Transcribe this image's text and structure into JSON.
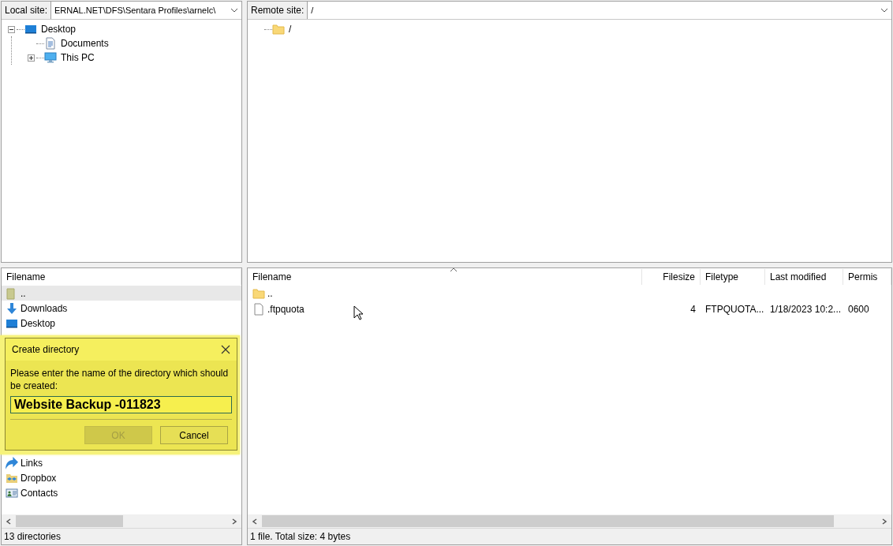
{
  "local_site": {
    "label": "Local site:",
    "path": "ERNAL.NET\\DFS\\Sentara Profiles\\arnelc\\"
  },
  "local_tree": [
    {
      "label": "Desktop",
      "kind": "desktop",
      "expanded": true,
      "children": [
        {
          "label": "Documents",
          "kind": "document"
        },
        {
          "label": "This PC",
          "kind": "computer",
          "expanded": false
        }
      ]
    }
  ],
  "remote_site": {
    "label": "Remote site:",
    "path": "/"
  },
  "remote_tree": [
    {
      "label": "/",
      "kind": "folder"
    }
  ],
  "local_files": {
    "columns": [
      "Filename"
    ],
    "rows": [
      {
        "name": "..",
        "kind": "parent",
        "selected": true
      },
      {
        "name": "Downloads",
        "kind": "download",
        "selected": false
      },
      {
        "name": "Desktop",
        "kind": "desktop",
        "selected": false
      },
      {
        "name": "Links",
        "kind": "link",
        "selected": false
      },
      {
        "name": "Dropbox",
        "kind": "dropbox",
        "selected": false
      },
      {
        "name": "Contacts",
        "kind": "contacts",
        "selected": false
      }
    ],
    "status": "13 directories"
  },
  "remote_files": {
    "columns": [
      "Filename",
      "Filesize",
      "Filetype",
      "Last modified",
      "Permis"
    ],
    "rows": [
      {
        "kind": "folder",
        "cells": [
          ".."
        ],
        "selected": false
      },
      {
        "kind": "file",
        "cells": [
          ".ftpquota",
          "4",
          "FTPQUOTA...",
          "1/18/2023 10:2...",
          "0600"
        ],
        "selected": false
      }
    ],
    "status": "1 file. Total size: 4 bytes"
  },
  "dialog": {
    "title": "Create directory",
    "message": "Please enter the name of the directory which should be created:",
    "value": "Website Backup -011823",
    "buttons": [
      {
        "label": "OK",
        "disabled": true
      },
      {
        "label": "Cancel",
        "disabled": false
      }
    ]
  }
}
